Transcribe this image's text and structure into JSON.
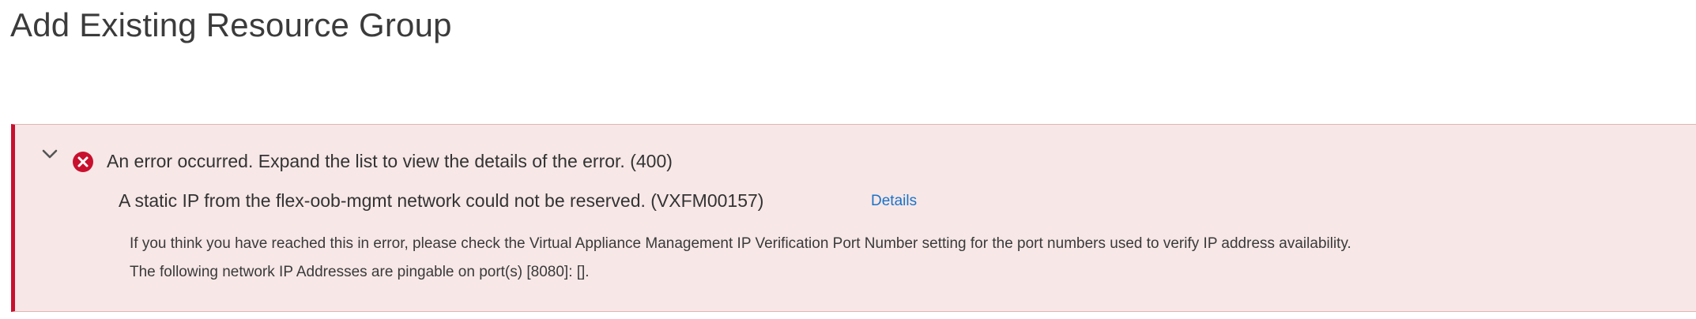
{
  "page": {
    "title": "Add Existing Resource Group"
  },
  "error_panel": {
    "summary": "An error occurred. Expand the list to view the details of the error. (400)",
    "message": "A static IP from the flex-oob-mgmt network could not be reserved. (VXFM00157)",
    "details_link": "Details",
    "detail_line_1": "If you think you have reached this in error, please check the Virtual Appliance Management IP Verification Port Number setting for the port numbers used to verify IP address availability.",
    "detail_line_2": "The following network IP Addresses are pingable on port(s) [8080]: [].",
    "icons": {
      "toggle": "chevron-down-icon",
      "status": "error-icon"
    },
    "colors": {
      "background": "#f7e7e7",
      "accent_border": "#c8102e",
      "error_icon": "#c8102e",
      "link": "#1a73c8"
    }
  }
}
